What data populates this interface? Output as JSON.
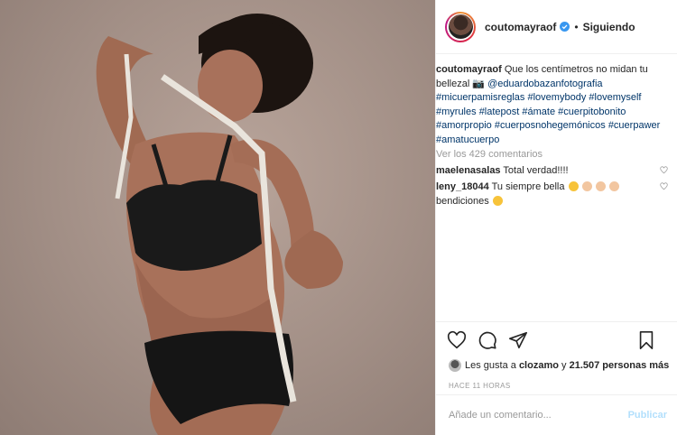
{
  "post": {
    "username": "coutomayraof",
    "follow_separator": "•",
    "follow_label": "Siguiendo",
    "caption": {
      "username": "coutomayraof",
      "text": "Que los centímetros no midan tu bellezal",
      "camera_emoji": "📷",
      "mention": "@eduardobazanfotografia",
      "hashtags": [
        "#micuerpamisreglas",
        "#lovemybody",
        "#lovemyself",
        "#myrules",
        "#latepost",
        "#ámate",
        "#cuerpitobonito",
        "#amorpropio",
        "#cuerposnohegemónicos",
        "#cuerpawer",
        "#amatucuerpo"
      ]
    },
    "view_all_comments": "Ver los 429 comentarios",
    "comments": [
      {
        "username": "maelenasalas",
        "text": "Total verdad!!!!"
      },
      {
        "username": "leny_18044",
        "text": "Tu siempre bella",
        "text2": "bendiciones"
      }
    ],
    "likes": {
      "prefix": "Les gusta a",
      "user": "clozamo",
      "middle": "y",
      "count": "21.507 personas más"
    },
    "time": "HACE 11 HORAS",
    "add_comment_placeholder": "Añade un comentario...",
    "publish_label": "Publicar"
  },
  "icons": [
    "verified-icon",
    "heart-icon",
    "comment-icon",
    "share-icon",
    "bookmark-icon"
  ],
  "colors": {
    "link": "#003569",
    "muted": "#999999",
    "publish_disabled": "#b2dffc",
    "verified": "#3897f0"
  }
}
